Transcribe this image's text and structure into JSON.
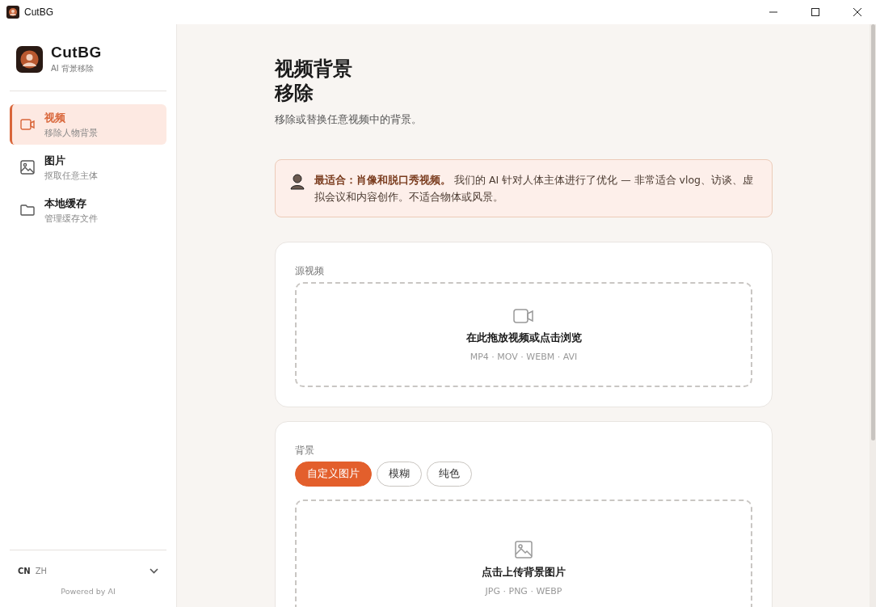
{
  "window": {
    "title": "CutBG"
  },
  "sidebar": {
    "brand": {
      "name": "CutBG",
      "tagline": "AI 背景移除"
    },
    "items": [
      {
        "kind": "video",
        "label": "视频",
        "sub": "移除人物背景",
        "selected": true
      },
      {
        "kind": "image",
        "label": "图片",
        "sub": "抠取任意主体",
        "selected": false
      },
      {
        "kind": "folder",
        "label": "本地缓存",
        "sub": "管理缓存文件",
        "selected": false
      }
    ],
    "language": {
      "code": "CN",
      "name": "ZH"
    },
    "footer": "Powered by AI"
  },
  "main": {
    "title_lines": [
      "视频背景",
      "移除"
    ],
    "subtitle": "移除或替换任意视频中的背景。",
    "notice": {
      "text": "**最适合：肖像和脱口秀视频。** 我们的 AI 针对人体主体进行了优化 — 非常适合 vlog、访谈、虚拟会议和内容创作。不适合物体或风景。"
    },
    "source": {
      "label": "源视频",
      "dropzone": {
        "kind": "video",
        "title": "在此拖放视频或点击浏览",
        "formats": "MP4 · MOV · WEBM · AVI"
      }
    },
    "background": {
      "label": "背景",
      "options": [
        {
          "label": "自定义图片",
          "selected": true
        },
        {
          "label": "模糊",
          "selected": false
        },
        {
          "label": "纯色",
          "selected": false
        }
      ],
      "dropzone": {
        "kind": "image",
        "title": "点击上传背景图片",
        "formats": "JPG · PNG · WEBP"
      }
    }
  }
}
